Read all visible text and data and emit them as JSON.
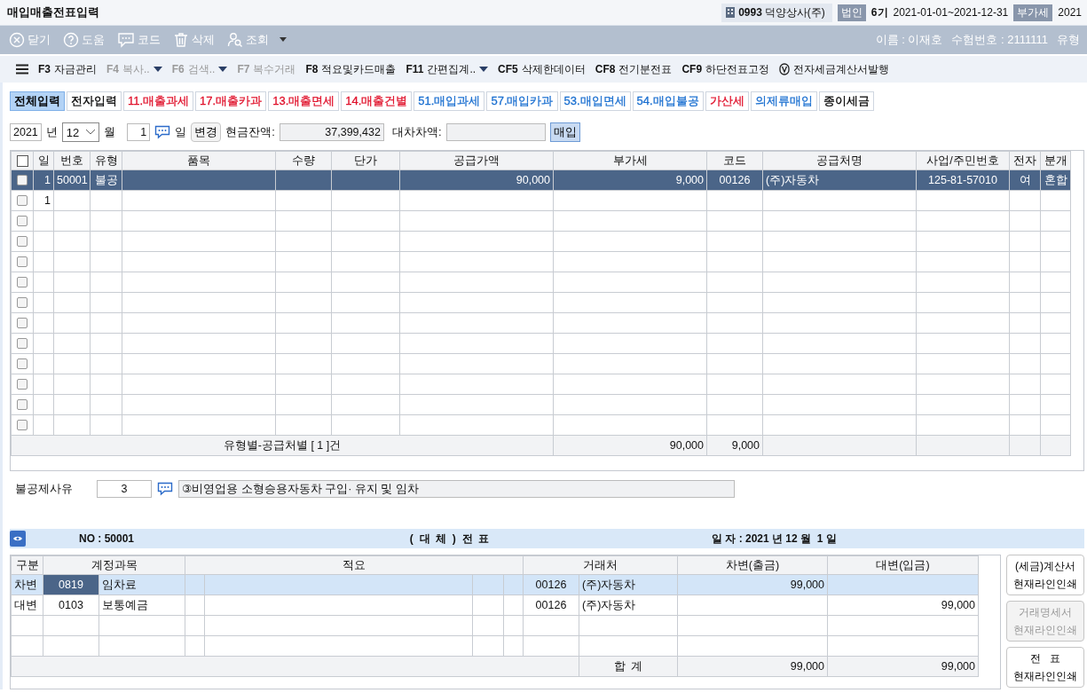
{
  "window": {
    "title": "매입매출전표입력"
  },
  "header_info": {
    "company_code": "0993",
    "company_name": "덕양상사(주)",
    "entity_badge": "법인",
    "term": "6기",
    "period": "2021-01-01~2021-12-31",
    "tax_badge": "부가세",
    "year": "2021"
  },
  "toolbar": {
    "buttons": [
      {
        "label": "닫기"
      },
      {
        "label": "도움"
      },
      {
        "label": "코드"
      },
      {
        "label": "삭제"
      },
      {
        "label": "조회"
      }
    ],
    "user_name": "이름 : 이재호",
    "exam_no": "수험번호 : 2111111",
    "type_label": "유형"
  },
  "function_bar": [
    {
      "kind": "key",
      "key": "F3",
      "label": "자금관리",
      "disabled": false,
      "dropdown": false
    },
    {
      "kind": "key",
      "key": "F4",
      "label": "복사..",
      "disabled": true,
      "dropdown": true
    },
    {
      "kind": "key",
      "key": "F6",
      "label": "검색..",
      "disabled": true,
      "dropdown": true
    },
    {
      "kind": "key",
      "key": "F7",
      "label": "복수거래",
      "disabled": true,
      "dropdown": false
    },
    {
      "kind": "key",
      "key": "F8",
      "label": "적요및카드매출",
      "disabled": false,
      "dropdown": false
    },
    {
      "kind": "key",
      "key": "F11",
      "label": "간편집계..",
      "disabled": false,
      "dropdown": true
    },
    {
      "kind": "key",
      "key": "CF5",
      "label": "삭제한데이터",
      "disabled": false,
      "dropdown": false
    },
    {
      "kind": "key",
      "key": "CF8",
      "label": "전기분전표",
      "disabled": false,
      "dropdown": false
    },
    {
      "kind": "key",
      "key": "CF9",
      "label": "하단전표고정",
      "disabled": false,
      "dropdown": false
    },
    {
      "kind": "icon",
      "label": "전자세금계산서발행",
      "disabled": false,
      "dropdown": false
    }
  ],
  "tabs": [
    {
      "label": "전체입력",
      "selected": true,
      "color": "#000000"
    },
    {
      "label": "전자입력",
      "selected": false,
      "color": "#000000"
    },
    {
      "label": "11.매출과세",
      "selected": false,
      "color": "#e0102a"
    },
    {
      "label": "17.매출카과",
      "selected": false,
      "color": "#e0102a"
    },
    {
      "label": "13.매출면세",
      "selected": false,
      "color": "#e0102a"
    },
    {
      "label": "14.매출건별",
      "selected": false,
      "color": "#e0102a"
    },
    {
      "label": "51.매입과세",
      "selected": false,
      "color": "#1a6fd0"
    },
    {
      "label": "57.매입카과",
      "selected": false,
      "color": "#1a6fd0"
    },
    {
      "label": "53.매입면세",
      "selected": false,
      "color": "#1a6fd0"
    },
    {
      "label": "54.매입불공",
      "selected": false,
      "color": "#1a6fd0"
    },
    {
      "label": "가산세",
      "selected": false,
      "color": "#e0102a"
    },
    {
      "label": "의제류매입",
      "selected": false,
      "color": "#1a6fd0"
    },
    {
      "label": "종이세금",
      "selected": false,
      "color": "#000000"
    }
  ],
  "date_bar": {
    "year": "2021",
    "year_unit": "년",
    "month": "12",
    "month_unit": "월",
    "day": "1",
    "day_unit": "일",
    "change_button": "변경",
    "cash_label": "현금잔액:",
    "cash_value": "37,399,432",
    "diff_label": "대차차액:",
    "purchase_button": "매입"
  },
  "entry_table": {
    "select_all_checked": false,
    "columns": [
      "일",
      "번호",
      "유형",
      "품목",
      "수량",
      "단가",
      "공급가액",
      "부가세",
      "코드",
      "공급처명",
      "사업/주민번호",
      "전자",
      "분개"
    ],
    "rows": [
      {
        "checked": false,
        "selected": true,
        "day": "1",
        "number": "50001",
        "type": "불공",
        "supply": "90,000",
        "vat": "9,000",
        "code": "00126",
        "supplier": "(주)자동차",
        "biz_no": "125-81-57010",
        "electronic": "여",
        "journal": "혼합"
      },
      {
        "checked": false,
        "selected": false,
        "day": "1"
      },
      {
        "checked": false,
        "selected": false
      },
      {
        "checked": false,
        "selected": false
      },
      {
        "checked": false,
        "selected": false
      },
      {
        "checked": false,
        "selected": false
      },
      {
        "checked": false,
        "selected": false
      },
      {
        "checked": false,
        "selected": false
      },
      {
        "checked": false,
        "selected": false
      },
      {
        "checked": false,
        "selected": false
      },
      {
        "checked": false,
        "selected": false
      },
      {
        "checked": false,
        "selected": false
      },
      {
        "checked": false,
        "selected": false
      }
    ],
    "summary": {
      "label": "유형별-공급처별 [ 1 ]건",
      "supply": "90,000",
      "vat": "9,000"
    }
  },
  "deduction": {
    "label": "불공제사유",
    "code": "3",
    "description": "③비영업용 소형승용자동차 구입· 유지 및 임차"
  },
  "voucher": {
    "no": "NO : 50001",
    "title": "(  대  체  )  전  표",
    "date": "일 자 : 2021 년 12 월  1 일"
  },
  "journal": {
    "columns": [
      "구분",
      "계정과목",
      "적요",
      "거래처",
      "차변(출금)",
      "대변(입금)"
    ],
    "rows": [
      {
        "selected": true,
        "side": "차변",
        "account_code": "0819",
        "account_name": "임차료",
        "partner_code": "00126",
        "partner_name": "(주)자동차",
        "debit": "99,000"
      },
      {
        "selected": false,
        "side": "대변",
        "account_code": "0103",
        "account_name": "보통예금",
        "partner_code": "00126",
        "partner_name": "(주)자동차",
        "credit": "99,000"
      },
      {
        "selected": false
      },
      {
        "selected": false
      }
    ],
    "total": {
      "label": "합  계",
      "debit": "99,000",
      "credit": "99,000"
    }
  },
  "print_buttons": [
    {
      "lines": [
        "(세금)계산서",
        "현재라인인쇄"
      ],
      "disabled": false
    },
    {
      "lines": [
        "거래명세서",
        "현재라인인쇄"
      ],
      "disabled": true
    },
    {
      "lines": [
        "전   표",
        "현재라인인쇄"
      ],
      "disabled": false
    }
  ]
}
